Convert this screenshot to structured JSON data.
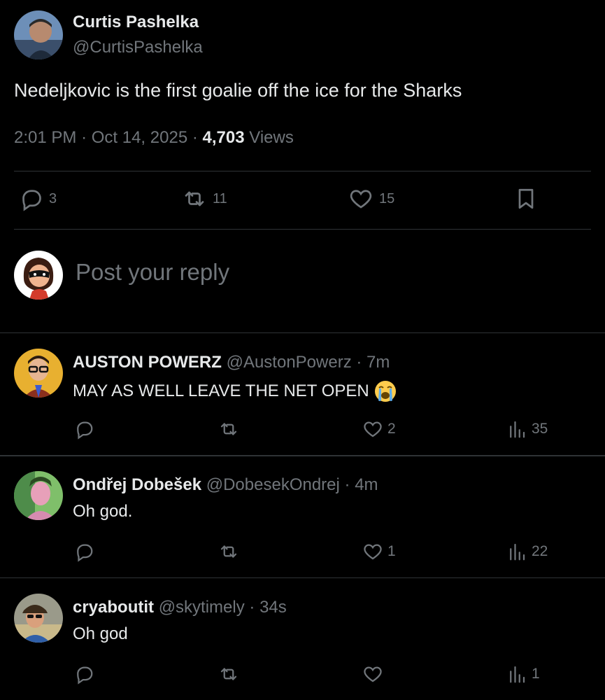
{
  "tweet": {
    "author_name": "Curtis Pashelka",
    "author_handle": "@CurtisPashelka",
    "text": "Nedeljkovic is the first goalie off the ice for the Sharks",
    "time": "2:01 PM",
    "date": "Oct 14, 2025",
    "views_count": "4,703",
    "views_label": "Views",
    "replies": "3",
    "reposts": "11",
    "likes": "15"
  },
  "composer": {
    "placeholder": "Post your reply"
  },
  "replies": [
    {
      "name": "AUSTON POWERZ",
      "handle": "@AustonPowerz",
      "time": "7m",
      "text": "MAY AS WELL LEAVE THE NET OPEN",
      "emoji": "loudly-crying-face-emoji",
      "likes": "2",
      "views": "35"
    },
    {
      "name": "Ondřej Dobešek",
      "handle": "@DobesekOndrej",
      "time": "4m",
      "text": "Oh god.",
      "likes": "1",
      "views": "22"
    },
    {
      "name": "cryaboutit",
      "handle": "@skytimely",
      "time": "34s",
      "text": "Oh god",
      "likes": "",
      "views": "1"
    }
  ],
  "colors": {
    "background": "#000000",
    "text": "#e7e9ea",
    "muted": "#71767b",
    "divider": "#2f3336"
  }
}
